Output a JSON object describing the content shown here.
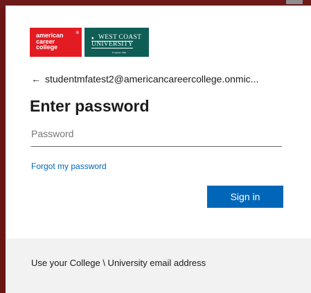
{
  "logos": {
    "acc_lines": [
      "american",
      "career",
      "college"
    ],
    "acc_reg": "®",
    "wcu_line1": "WEST COAST",
    "wcu_line2": "UNIVERSITY",
    "wcu_founded": "Founded 1909",
    "acc_color": "#e31b23",
    "wcu_color": "#0f5e56"
  },
  "account": {
    "back_icon": "back-arrow-icon",
    "email": "studentmfatest2@americancareercollege.onmic..."
  },
  "title": "Enter password",
  "password": {
    "placeholder": "Password",
    "value": ""
  },
  "forgot_label": "Forgot my password",
  "signin_label": "Sign in",
  "footer_text": "Use your College \\ University email address",
  "colors": {
    "accent": "#0067b8",
    "backdrop": "#6b1414",
    "footer_bg": "#f2f2f2"
  }
}
